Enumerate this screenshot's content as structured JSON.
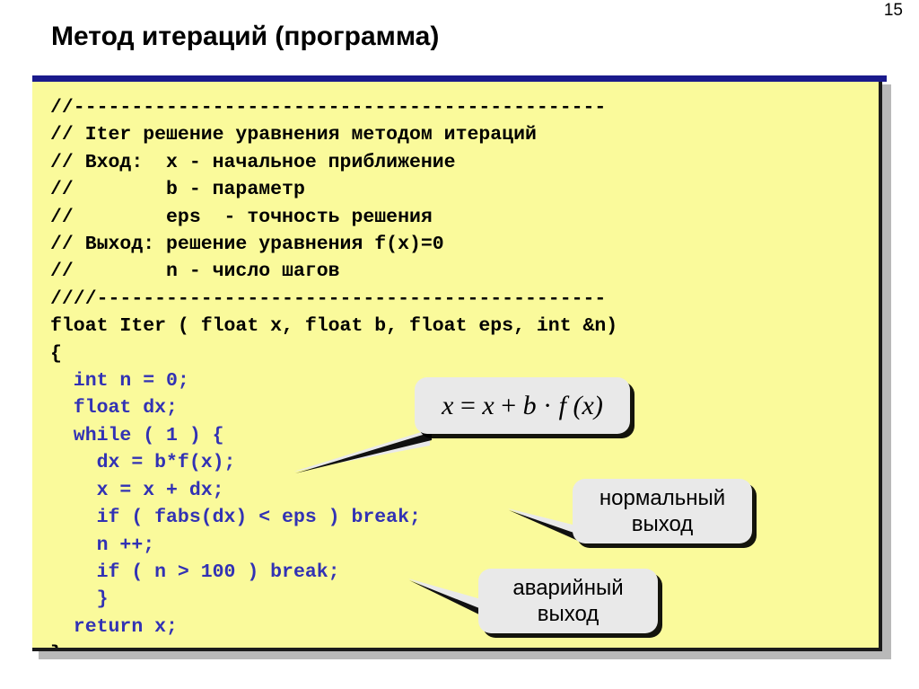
{
  "slide": {
    "number": "15",
    "title": "Метод итераций (программа)"
  },
  "code": {
    "language": "C",
    "background_color": "#FAFA9B",
    "comment_color": "#000000",
    "body_color": "#3232B4",
    "lines": [
      {
        "text": "//----------------------------------------------",
        "color": "black"
      },
      {
        "text": "// Iter решение уравнения методом итераций",
        "color": "black"
      },
      {
        "text": "// Вход:  x - начальное приближение",
        "color": "black"
      },
      {
        "text": "//        b - параметр",
        "color": "black"
      },
      {
        "text": "//        eps  - точность решения",
        "color": "black"
      },
      {
        "text": "// Выход: решение уравнения f(x)=0",
        "color": "black"
      },
      {
        "text": "//        n - число шагов",
        "color": "black"
      },
      {
        "text": "////--------------------------------------------",
        "color": "black"
      },
      {
        "text": "float Iter ( float x, float b, float eps, int &n)",
        "color": "black"
      },
      {
        "text": "{",
        "color": "black"
      },
      {
        "text": "  int n = 0;",
        "color": "blue"
      },
      {
        "text": "  float dx;",
        "color": "blue"
      },
      {
        "text": "  while ( 1 ) {",
        "color": "blue"
      },
      {
        "text": "    dx = b*f(x);",
        "color": "blue"
      },
      {
        "text": "    x = x + dx;",
        "color": "blue"
      },
      {
        "text": "    if ( fabs(dx) < eps ) break;",
        "color": "blue"
      },
      {
        "text": "    n ++;",
        "color": "blue"
      },
      {
        "text": "    if ( n > 100 ) break;",
        "color": "blue"
      },
      {
        "text": "    }",
        "color": "blue"
      },
      {
        "text": "  return x;",
        "color": "blue"
      },
      {
        "text": "}",
        "color": "black"
      }
    ]
  },
  "callouts": {
    "formula": {
      "lhs": "x",
      "eq": " = ",
      "rhs_x": "x",
      "plus": " + ",
      "b": "b",
      "dot": " · ",
      "f": "f",
      "arg": " (x)",
      "full_text": "x = x + b · f (x)"
    },
    "normal_exit": {
      "line1": "нормальный",
      "line2": "выход"
    },
    "emergency_exit": {
      "line1": "аварийный",
      "line2": "выход"
    }
  }
}
